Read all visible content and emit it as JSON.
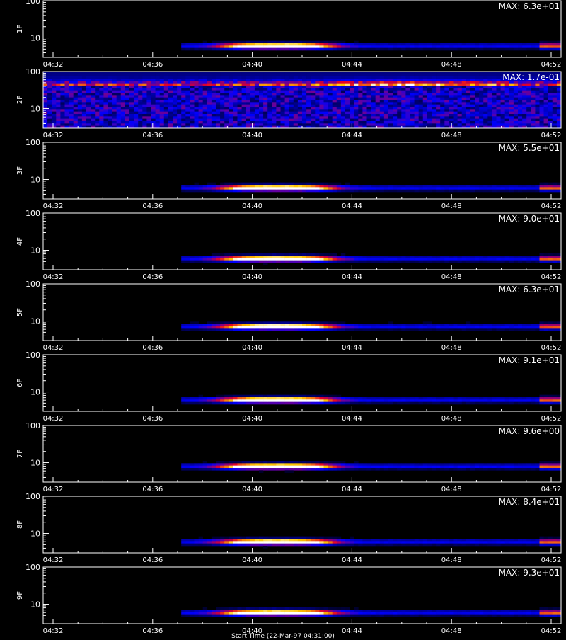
{
  "figure": {
    "xlabel": "Start Time (22-Mar-97 04:31:00)"
  },
  "chart_data": [
    {
      "type": "heatmap",
      "ylabel": "1F",
      "max_label": "MAX: 6.3e+01",
      "x_ticks": [
        "04:32",
        "04:36",
        "04:40",
        "04:44",
        "04:48",
        "04:52"
      ],
      "y_ticks": [
        "10",
        "100"
      ],
      "y_scale": "log",
      "y_range": [
        3,
        100
      ],
      "hot_time_range": [
        "04:39",
        "04:43"
      ],
      "hot_y": 6,
      "background": "low"
    },
    {
      "type": "heatmap",
      "ylabel": "2F",
      "max_label": "MAX: 1.7e-01",
      "x_ticks": [
        "04:32",
        "04:36",
        "04:40",
        "04:44",
        "04:48",
        "04:52"
      ],
      "y_ticks": [
        "10",
        "100"
      ],
      "y_scale": "log",
      "y_range": [
        3,
        100
      ],
      "hot_time_range": [
        "04:44",
        "04:49"
      ],
      "hot_y": 40,
      "background": "noisy"
    },
    {
      "type": "heatmap",
      "ylabel": "3F",
      "max_label": "MAX: 5.5e+01",
      "x_ticks": [
        "04:32",
        "04:36",
        "04:40",
        "04:44",
        "04:48",
        "04:52"
      ],
      "y_ticks": [
        "10",
        "100"
      ],
      "y_scale": "log",
      "y_range": [
        3,
        100
      ],
      "hot_time_range": [
        "04:39",
        "04:43"
      ],
      "hot_y": 6,
      "background": "low"
    },
    {
      "type": "heatmap",
      "ylabel": "4F",
      "max_label": "MAX: 9.0e+01",
      "x_ticks": [
        "04:32",
        "04:36",
        "04:40",
        "04:44",
        "04:48",
        "04:52"
      ],
      "y_ticks": [
        "10",
        "100"
      ],
      "y_scale": "log",
      "y_range": [
        3,
        100
      ],
      "hot_time_range": [
        "04:39",
        "04:43"
      ],
      "hot_y": 6,
      "background": "low"
    },
    {
      "type": "heatmap",
      "ylabel": "5F",
      "max_label": "MAX: 6.3e+01",
      "x_ticks": [
        "04:32",
        "04:36",
        "04:40",
        "04:44",
        "04:48",
        "04:52"
      ],
      "y_ticks": [
        "10",
        "100"
      ],
      "y_scale": "log",
      "y_range": [
        3,
        100
      ],
      "hot_time_range": [
        "04:39",
        "04:43"
      ],
      "hot_y": 7,
      "background": "low"
    },
    {
      "type": "heatmap",
      "ylabel": "6F",
      "max_label": "MAX: 9.1e+01",
      "x_ticks": [
        "04:32",
        "04:36",
        "04:40",
        "04:44",
        "04:48",
        "04:52"
      ],
      "y_ticks": [
        "10",
        "100"
      ],
      "y_scale": "log",
      "y_range": [
        3,
        100
      ],
      "hot_time_range": [
        "04:39",
        "04:43"
      ],
      "hot_y": 6,
      "background": "low"
    },
    {
      "type": "heatmap",
      "ylabel": "7F",
      "max_label": "MAX: 9.6e+00",
      "x_ticks": [
        "04:32",
        "04:36",
        "04:40",
        "04:44",
        "04:48",
        "04:52"
      ],
      "y_ticks": [
        "10",
        "100"
      ],
      "y_scale": "log",
      "y_range": [
        3,
        100
      ],
      "hot_time_range": [
        "04:39",
        "04:43"
      ],
      "hot_y": 8,
      "background": "low"
    },
    {
      "type": "heatmap",
      "ylabel": "8F",
      "max_label": "MAX: 8.4e+01",
      "x_ticks": [
        "04:32",
        "04:36",
        "04:40",
        "04:44",
        "04:48",
        "04:52"
      ],
      "y_ticks": [
        "10",
        "100"
      ],
      "y_scale": "log",
      "y_range": [
        3,
        100
      ],
      "hot_time_range": [
        "04:39",
        "04:43"
      ],
      "hot_y": 6,
      "background": "low"
    },
    {
      "type": "heatmap",
      "ylabel": "9F",
      "max_label": "MAX: 9.3e+01",
      "x_ticks": [
        "04:32",
        "04:36",
        "04:40",
        "04:44",
        "04:48",
        "04:52"
      ],
      "y_ticks": [
        "10",
        "100"
      ],
      "y_scale": "log",
      "y_range": [
        3,
        100
      ],
      "hot_time_range": [
        "04:39",
        "04:43"
      ],
      "hot_y": 6,
      "background": "low"
    }
  ]
}
